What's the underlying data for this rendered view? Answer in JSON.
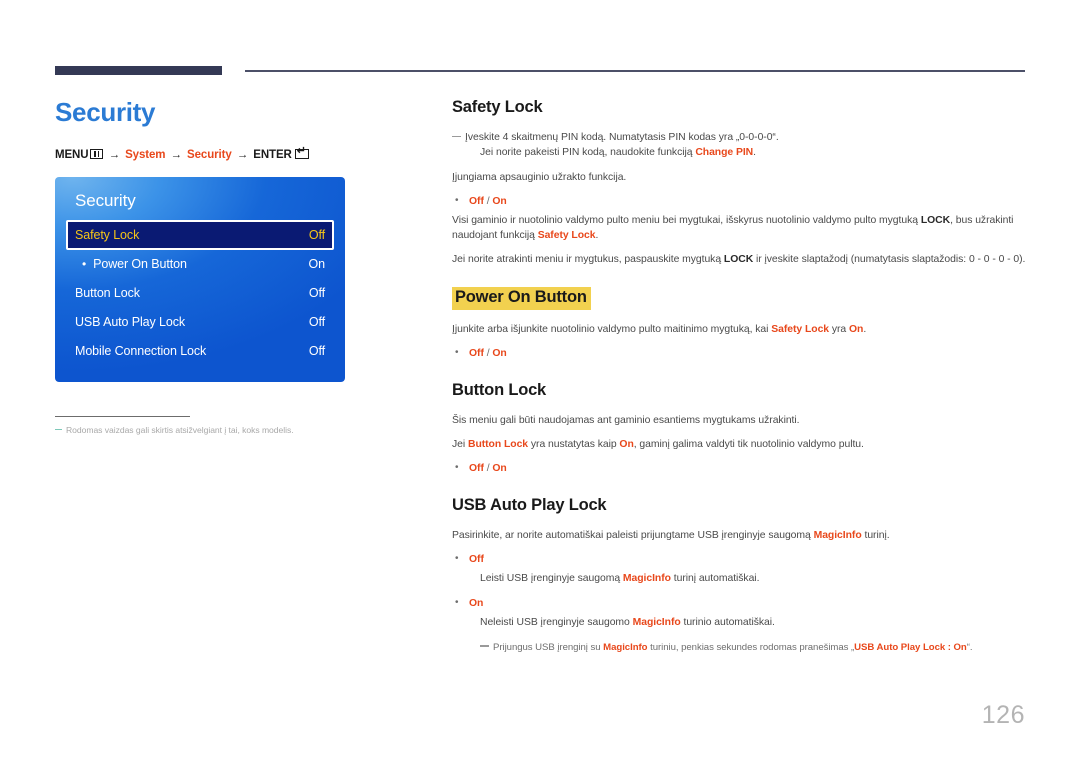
{
  "header": {
    "thick_rule_color": "#343955",
    "thin_rule_color": "#4c5068"
  },
  "left": {
    "page_title": "Security",
    "breadcrumb": {
      "menu_label": "MENU",
      "menu_icon": "menu-grid-icon",
      "arrow": "→",
      "step1": "System",
      "step2": "Security",
      "enter_label": "ENTER",
      "enter_icon": "enter-key-icon"
    },
    "osd": {
      "title": "Security",
      "rows": [
        {
          "label": "Safety Lock",
          "value": "Off",
          "selected": true,
          "sub": false
        },
        {
          "label": "Power On Button",
          "value": "On",
          "selected": false,
          "sub": true
        },
        {
          "label": "Button Lock",
          "value": "Off",
          "selected": false,
          "sub": false
        },
        {
          "label": "USB Auto Play Lock",
          "value": "Off",
          "selected": false,
          "sub": false
        },
        {
          "label": "Mobile Connection Lock",
          "value": "Off",
          "selected": false,
          "sub": false
        }
      ],
      "selected_bg": "#0a1a73",
      "selected_text": "#f5c518"
    },
    "note": "Rodomas vaizdas gali skirtis atsižvelgiant į tai, koks modelis."
  },
  "right": {
    "sections": [
      {
        "id": "safety-lock",
        "heading": "Safety Lock",
        "highlight": false
      },
      {
        "id": "power-on-button",
        "heading": "Power On Button",
        "highlight": true
      },
      {
        "id": "button-lock",
        "heading": "Button Lock",
        "highlight": false
      },
      {
        "id": "usb-auto-play-lock",
        "heading": "USB Auto Play Lock",
        "highlight": false
      }
    ],
    "safety_lock": {
      "note_line1": "Įveskite 4 skaitmenų PIN kodą. Numatytasis PIN kodas yra „0-0-0-0“.",
      "note_line2_pre": "Jei norite pakeisti PIN kodą, naudokite funkciją ",
      "note_line2_accent": "Change PIN",
      "note_line2_post": ".",
      "para1": "Įjungiama apsauginio užrakto funkcija.",
      "options": "Off / On",
      "option_off": "Off",
      "option_on": "On",
      "para2_a": "Visi gaminio ir nuotolinio valdymo pulto meniu bei mygtukai, išskyrus nuotolinio valdymo pulto mygtuką ",
      "para2_bold": "LOCK",
      "para2_b": ", bus užrakinti naudojant funkciją ",
      "para2_accent": "Safety Lock",
      "para2_c": ".",
      "para3_a": "Jei norite atrakinti meniu ir mygtukus, paspauskite mygtuką ",
      "para3_bold": "LOCK",
      "para3_b": " ir įveskite slaptažodį (numatytasis slaptažodis: 0 - 0 - 0 - 0)."
    },
    "power_on_button": {
      "para_a": "Įjunkite arba išjunkite nuotolinio valdymo pulto maitinimo mygtuką, kai ",
      "para_accent1": "Safety Lock",
      "para_b": " yra ",
      "para_accent2": "On",
      "para_c": ".",
      "option_off": "Off",
      "option_on": "On"
    },
    "button_lock": {
      "para1": "Šis meniu gali būti naudojamas ant gaminio esantiems mygtukams užrakinti.",
      "para2_a": "Jei ",
      "para2_accent1": "Button Lock",
      "para2_b": " yra nustatytas kaip ",
      "para2_accent2": "On",
      "para2_c": ", gaminį galima valdyti tik nuotolinio valdymo pultu.",
      "option_off": "Off",
      "option_on": "On"
    },
    "usb_auto_play_lock": {
      "para1_a": "Pasirinkite, ar norite automatiškai paleisti prijungtame USB įrenginyje saugomą ",
      "para1_accent": "MagicInfo",
      "para1_b": " turinį.",
      "opt1_label": "Off",
      "opt1_desc_a": "Leisti USB įrenginyje saugomą ",
      "opt1_desc_accent": "MagicInfo",
      "opt1_desc_b": " turinį automatiškai.",
      "opt2_label": "On",
      "opt2_desc_a": "Neleisti USB įrenginyje saugomo ",
      "opt2_desc_accent": "MagicInfo",
      "opt2_desc_b": " turinio automatiškai.",
      "tip_a": "Prijungus USB įrenginį su ",
      "tip_accent1": "MagicInfo",
      "tip_b": " turiniu, penkias sekundes rodomas pranešimas „",
      "tip_accent2": "USB Auto Play Lock : On",
      "tip_c": "“."
    }
  },
  "footer": {
    "page_number": "126"
  }
}
